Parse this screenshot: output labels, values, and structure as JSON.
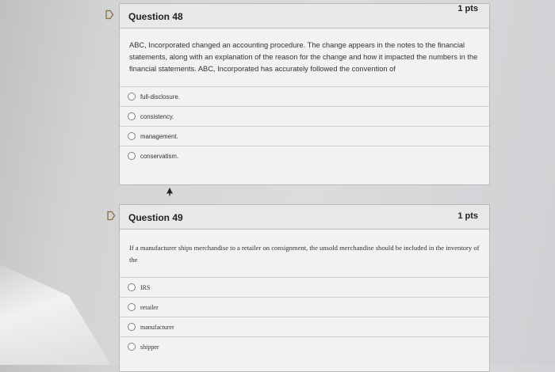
{
  "questions": [
    {
      "title": "Question 48",
      "points": "1 pts",
      "text": "ABC, Incorporated changed an accounting procedure. The change appears in the notes to the financial statements, along with an explanation of the reason for the change and how it impacted the numbers in the financial statements. ABC, Incorporated has accurately followed the convention of",
      "options": [
        "full-disclosure.",
        "consistency.",
        "management.",
        "conservatism."
      ]
    },
    {
      "title": "Question 49",
      "points": "1 pts",
      "text": "If a manufacturer ships merchandise to a retailer on consignment, the unsold merchandise should be included in the inventory of the",
      "options": [
        "IRS",
        "retailer",
        "manufacturer",
        "shipper"
      ]
    }
  ],
  "icons": [
    "flag-icon",
    "mouse-cursor-icon"
  ],
  "colors": {
    "card_bg": "#f2f2f3",
    "header_bg": "#e8e8ea",
    "page_bg": "#d6d7d9"
  }
}
